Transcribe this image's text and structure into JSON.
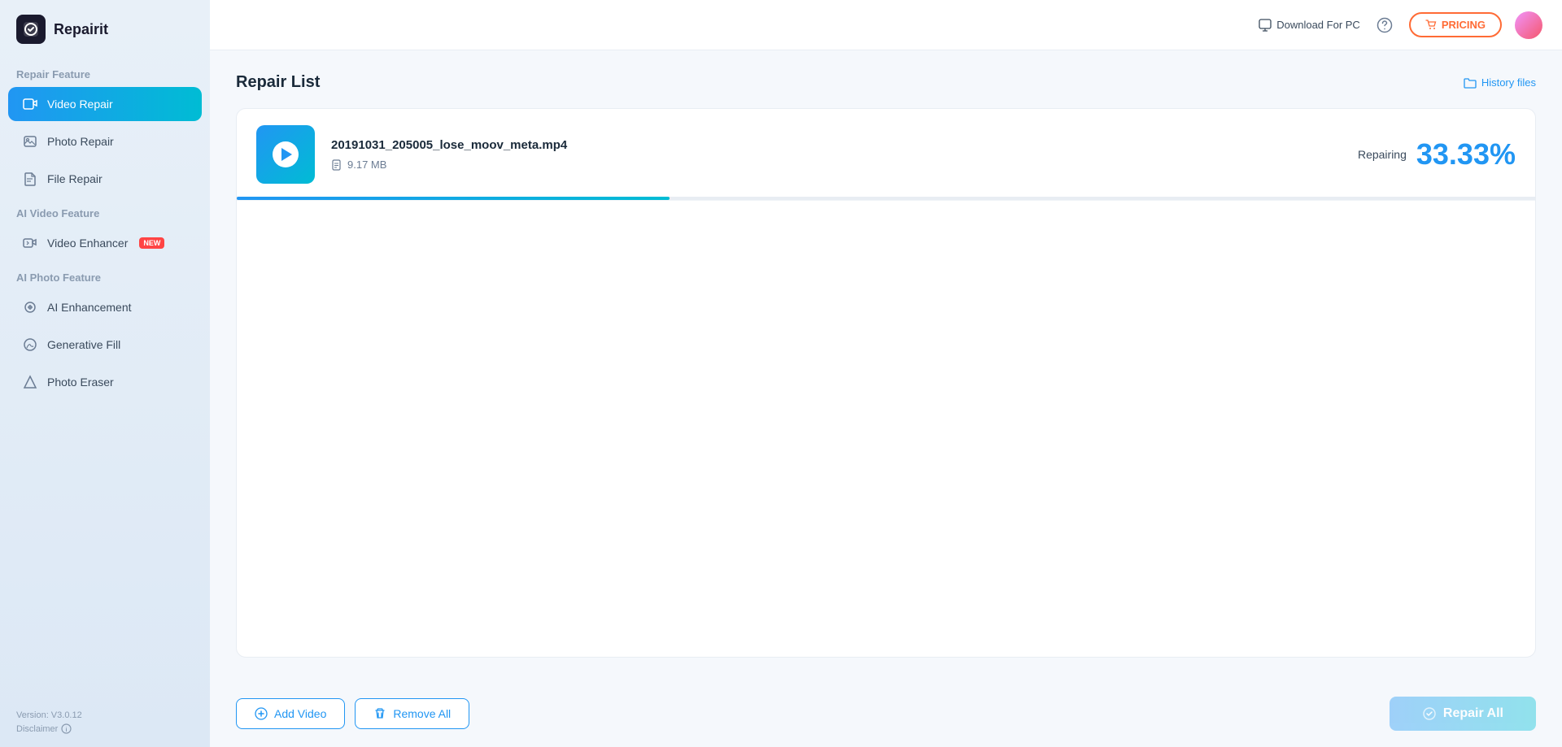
{
  "app": {
    "logo_text": "Repairit",
    "logo_icon": "🔧"
  },
  "sidebar": {
    "repair_feature_label": "Repair Feature",
    "nav_items": [
      {
        "id": "video-repair",
        "label": "Video Repair",
        "icon": "▶",
        "active": true,
        "badge": null
      },
      {
        "id": "photo-repair",
        "label": "Photo Repair",
        "icon": "🖼",
        "active": false,
        "badge": null
      },
      {
        "id": "file-repair",
        "label": "File Repair",
        "icon": "📄",
        "active": false,
        "badge": null
      }
    ],
    "ai_video_label": "AI Video Feature",
    "ai_video_items": [
      {
        "id": "video-enhancer",
        "label": "Video Enhancer",
        "icon": "🎬",
        "badge": "NEW"
      }
    ],
    "ai_photo_label": "AI Photo Feature",
    "ai_photo_items": [
      {
        "id": "ai-enhancement",
        "label": "AI Enhancement",
        "icon": "✨",
        "badge": null
      },
      {
        "id": "generative-fill",
        "label": "Generative Fill",
        "icon": "🎨",
        "badge": null
      },
      {
        "id": "photo-eraser",
        "label": "Photo Eraser",
        "icon": "◇",
        "badge": null
      }
    ],
    "version": "Version: V3.0.12",
    "disclaimer": "Disclaimer"
  },
  "header": {
    "download_label": "Download For PC",
    "pricing_label": "PRICING",
    "pricing_icon": "🛒"
  },
  "content": {
    "page_title": "Repair List",
    "history_files_label": "History files",
    "repair_item": {
      "file_name": "20191031_205005_lose_moov_meta.mp4",
      "file_size": "9.17 MB",
      "status_label": "Repairing",
      "percent": "33.33%",
      "progress": 33.33
    }
  },
  "footer": {
    "add_video_label": "Add Video",
    "remove_all_label": "Remove All",
    "repair_all_label": "Repair All"
  }
}
